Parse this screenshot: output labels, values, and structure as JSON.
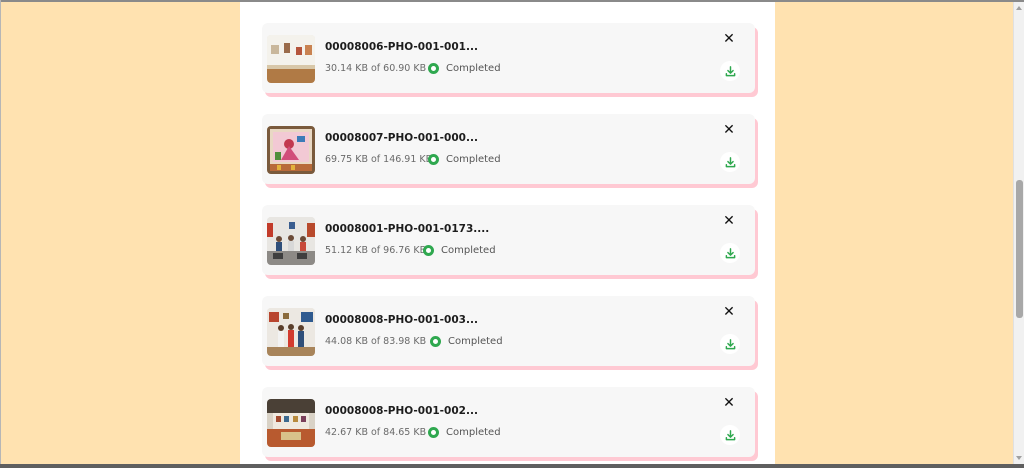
{
  "colors": {
    "page_background": "#ffe2b0",
    "card_background": "#f7f7f7",
    "card_shadow": "#ffc9d3",
    "status_green": "#2fa84f"
  },
  "downloads": [
    {
      "file_name": "00008006-PHO-001-001...",
      "size_text": "30.14 KB of 60.90 KB",
      "status": "Completed",
      "thumbnail": "gallery-room-photo"
    },
    {
      "file_name": "00008007-PHO-001-000...",
      "size_text": "69.75 KB of 146.91 KB",
      "status": "Completed",
      "thumbnail": "painting-photo"
    },
    {
      "file_name": "00008001-PHO-001-0173....",
      "size_text": "51.12 KB of 96.76 KB",
      "status": "Completed",
      "thumbnail": "group-seated-photo"
    },
    {
      "file_name": "00008008-PHO-001-003...",
      "size_text": "44.08 KB of 83.98 KB",
      "status": "Completed",
      "thumbnail": "group-standing-photo"
    },
    {
      "file_name": "00008008-PHO-001-002...",
      "size_text": "42.67 KB of 84.65 KB",
      "status": "Completed",
      "thumbnail": "exhibition-hall-photo"
    }
  ],
  "icons": {
    "close": "close-icon",
    "download": "download-icon",
    "status": "check-circle-icon"
  }
}
